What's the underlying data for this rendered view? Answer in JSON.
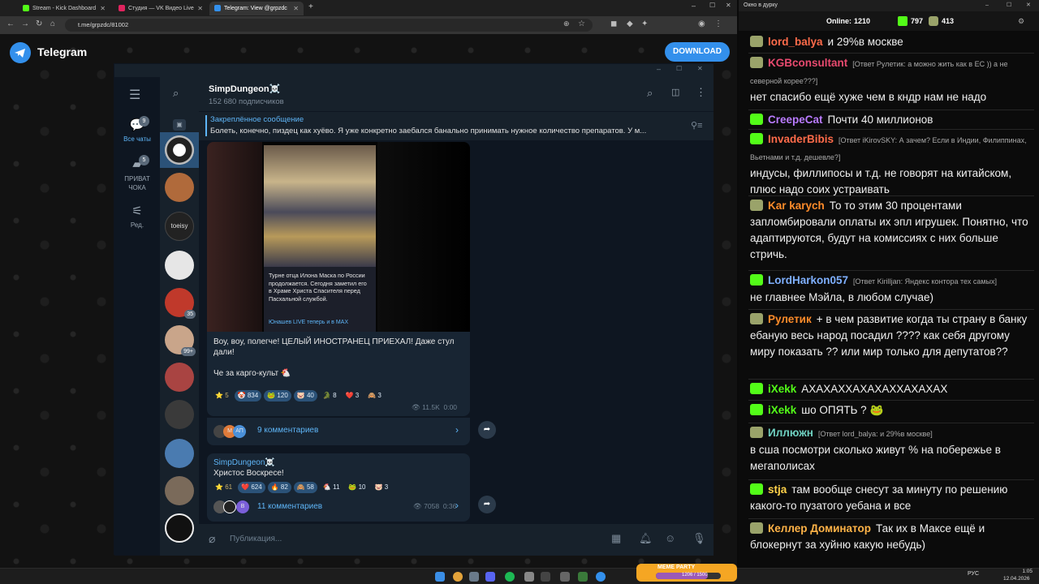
{
  "browser": {
    "tabs": [
      {
        "label": "Stream - Kick Dashboard",
        "color": "#53fc18"
      },
      {
        "label": "Студия — VK Видео Live",
        "color": "#e0245e"
      },
      {
        "label": "Telegram: View @grpzdc",
        "color": "#3390ec"
      }
    ],
    "new_tab": "+",
    "url": "t.me/grpzdc/81002"
  },
  "tg_web": {
    "brand": "Telegram",
    "download_label": "DOWNLOAD"
  },
  "tg": {
    "nav": [
      {
        "label": "Все чаты",
        "badge": "9",
        "icon": "chat-bubbles-icon"
      },
      {
        "label": "ПРИВАТ ЧОКА",
        "badge": "5",
        "icon": "folder-icon"
      },
      {
        "label": "Ред.",
        "badge": "",
        "icon": "edit-folders-icon"
      }
    ],
    "chatlist_badges": [
      "35",
      "99+"
    ],
    "channel": {
      "name": "SimpDungeon☠️",
      "subscribers": "152 680 подписчиков"
    },
    "pinned": {
      "title": "Закреплённое сообщение",
      "text": "Болеть, конечно, пиздец как хуёво. Я уже конкретно заебался банально принимать нужное количество препаратов. У м..."
    },
    "post1": {
      "caption_in_image": "Турне отца Илона Маска по России продолжается. Сегодня заметил его в Храме Христа Спасителя перед Пасхальной службой.",
      "caption_source": "Юнашев LIVE теперь и в MAX",
      "text1": "Воу, воу, полегче! ЦЕЛЫЙ ИНОСТРАНЕЦ ПРИЕХАЛ! Даже стул дали!",
      "text2": "Че за карго-культ 🐔",
      "reactions": [
        {
          "e": "⭐",
          "n": "5",
          "star": true
        },
        {
          "e": "🤡",
          "n": "834"
        },
        {
          "e": "🐸",
          "n": "120"
        },
        {
          "e": "🐷",
          "n": "40"
        },
        {
          "e": "🐊",
          "n": "8"
        },
        {
          "e": "❤️",
          "n": "3"
        },
        {
          "e": "🙈",
          "n": "3"
        }
      ],
      "views": "11.5K",
      "time": "0:00",
      "comments": "9 комментариев",
      "commenter_initials": [
        "М",
        "АП"
      ]
    },
    "post2": {
      "author": "SimpDungeon☠️",
      "text": "Христос Воскресе!",
      "reactions": [
        {
          "e": "⭐",
          "n": "61",
          "star": true
        },
        {
          "e": "❤️",
          "n": "624"
        },
        {
          "e": "🔥",
          "n": "82"
        },
        {
          "e": "🙈",
          "n": "58"
        },
        {
          "e": "🐔",
          "n": "11"
        },
        {
          "e": "🐸",
          "n": "10"
        },
        {
          "e": "🐷",
          "n": "3"
        }
      ],
      "views": "7058",
      "time": "0:36",
      "comments": "11 комментариев",
      "commenter_initials": [
        "В"
      ]
    },
    "composer_placeholder": "Публикация..."
  },
  "stream": {
    "window_title": "Окно в дурку",
    "online_label": "Online:",
    "online": "1210",
    "kick_viewers": "797",
    "other_viewers": "413",
    "messages": [
      {
        "badge": "p",
        "user": "lord_balya",
        "color": "#ff6b4a",
        "reply": "",
        "text": "и 29%в москве"
      },
      {
        "badge": "p",
        "user": "KGBconsultant",
        "color": "#e84a6f",
        "reply": "[Ответ Рулетик: а можно жить как в ЕС )) а не северной корее???]",
        "text": "нет спасибо ещё хуже чем в кндр нам не надо"
      },
      {
        "badge": "k",
        "user": "CreepeCat",
        "color": "#b97bff",
        "reply": "",
        "text": "Почти 40 миллионов"
      },
      {
        "badge": "k",
        "user": "InvaderBibis",
        "color": "#ff6b4a",
        "reply": "[Ответ iKirovSKY: А зачем? Если в Индии, Филиппинах, Вьетнами и т.д. дешевле?]",
        "text": "индусы, филлипосы и т.д. не говорят на китайском, плюс надо соих устраивать"
      },
      {
        "badge": "p",
        "user": "Kar karych",
        "color": "#ff8c2a",
        "reply": "",
        "text": "То то этим 30 процентами запломбировали оплаты их эпл игрушек. Понятно, что адаптируются, будут на комиссиях с них больше стричь."
      },
      {
        "badge": "k",
        "user": "LordHarkon057",
        "color": "#7fb0ff",
        "reply": "[Ответ Kirilljan: Яндекс контора тех самых]",
        "text": "не главнее Мэйла, в любом случае)"
      },
      {
        "badge": "p",
        "user": "Рулетик",
        "color": "#ff8c2a",
        "reply": "",
        "text": "+ в чем развитие когда ты страну в банку ебаную весь народ посадил ???? как себя другому миру показать ?? или мир только для депутатов??"
      },
      {
        "badge": "k",
        "user": "iXekk",
        "color": "#53fc18",
        "reply": "",
        "text": "АХАХАХХАХАХАХХАХАХАХ"
      },
      {
        "badge": "k",
        "user": "iXekk",
        "color": "#53fc18",
        "reply": "",
        "text": "шо ОПЯТЬ ? 🐸"
      },
      {
        "badge": "p",
        "user": "Иллюжн",
        "color": "#6fd1c1",
        "reply": "[Ответ lord_balya: и 29%в москве]",
        "text": "в сша посмотри сколько живут % на побережье в мегаполисах"
      },
      {
        "badge": "k",
        "user": "stja",
        "color": "#ffd24a",
        "reply": "",
        "text": "там вообще снесут за минуту по решению какого-то пузатого уебана и все"
      },
      {
        "badge": "p",
        "user": "Келлер Доминатор",
        "color": "#ffb347",
        "reply": "",
        "text": "Так их в Максе ещё и блокернут за хуйню какую небудь)"
      }
    ]
  },
  "taskbar": {
    "widget_label": "MEME PARTY",
    "widget_value": "1206 / 1500",
    "lang": "РУС",
    "time": "1:05",
    "date": "12.04.2026"
  }
}
